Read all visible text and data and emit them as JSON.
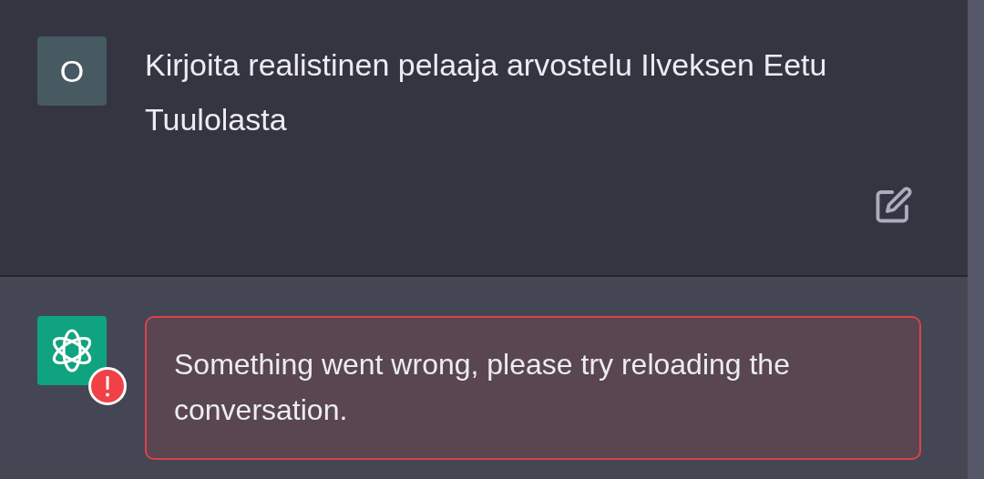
{
  "messages": [
    {
      "kind": "user",
      "avatar": "O",
      "text": "Kirjoita realistinen pelaaja arvostelu Ilveksen Eetu Tuulolasta"
    },
    {
      "kind": "error",
      "text": "Something went wrong, please try reloading the conversation."
    }
  ]
}
